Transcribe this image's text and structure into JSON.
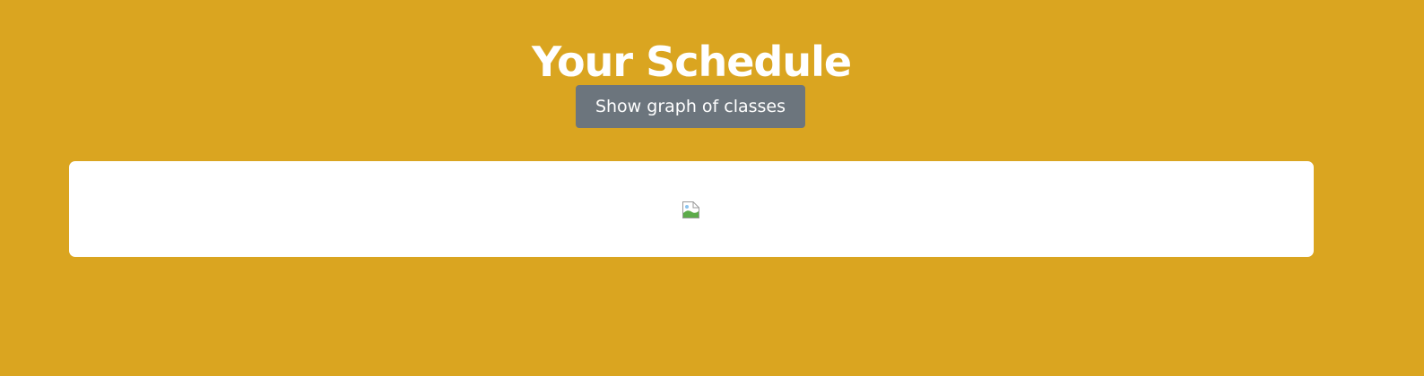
{
  "page": {
    "title": "Your Schedule",
    "background_color": "#DAA520"
  },
  "toolbar": {
    "show_graph_label": "Show graph of classes",
    "button_color": "#6c757d"
  },
  "schedule": {
    "card_color": "#ffffff",
    "image_icon": "broken-image-icon"
  }
}
